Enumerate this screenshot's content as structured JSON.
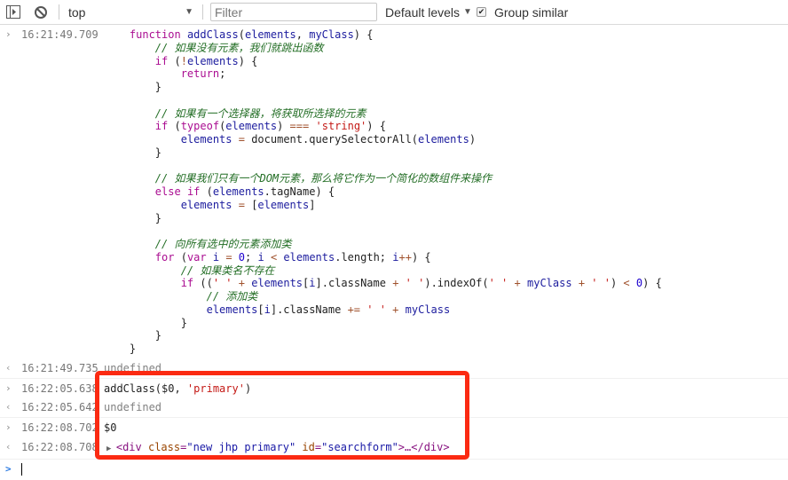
{
  "toolbar": {
    "context": "top",
    "filter_placeholder": "Filter",
    "levels": "Default levels",
    "group_similar": "Group similar",
    "group_similar_checked": true
  },
  "entries": [
    {
      "timestamp": "16:21:49.709",
      "kind": "input",
      "code": [
        [
          [
            "p",
            "    "
          ],
          [
            "k",
            "function"
          ],
          [
            "p",
            " "
          ],
          [
            "v",
            "addClass"
          ],
          [
            "p",
            "("
          ],
          [
            "v",
            "elements"
          ],
          [
            "p",
            ", "
          ],
          [
            "v",
            "myClass"
          ],
          [
            "p",
            ") {"
          ]
        ],
        [
          [
            "c",
            "        // 如果没有元素，我们就跳出函数"
          ]
        ],
        [
          [
            "p",
            "        "
          ],
          [
            "k",
            "if"
          ],
          [
            "p",
            " ("
          ],
          [
            "o",
            "!"
          ],
          [
            "v",
            "elements"
          ],
          [
            "p",
            ") {"
          ]
        ],
        [
          [
            "p",
            "            "
          ],
          [
            "k",
            "return"
          ],
          [
            "p",
            ";"
          ]
        ],
        [
          [
            "p",
            "        }"
          ]
        ],
        [],
        [
          [
            "c",
            "        // 如果有一个选择器，将获取所选择的元素"
          ]
        ],
        [
          [
            "p",
            "        "
          ],
          [
            "k",
            "if"
          ],
          [
            "p",
            " ("
          ],
          [
            "k",
            "typeof"
          ],
          [
            "p",
            "("
          ],
          [
            "v",
            "elements"
          ],
          [
            "p",
            ") "
          ],
          [
            "o",
            "==="
          ],
          [
            "p",
            " "
          ],
          [
            "s",
            "'string'"
          ],
          [
            "p",
            ") {"
          ]
        ],
        [
          [
            "p",
            "            "
          ],
          [
            "v",
            "elements"
          ],
          [
            "p",
            " "
          ],
          [
            "o",
            "="
          ],
          [
            "p",
            " document.querySelectorAll("
          ],
          [
            "v",
            "elements"
          ],
          [
            "p",
            ")"
          ]
        ],
        [
          [
            "p",
            "        }"
          ]
        ],
        [],
        [
          [
            "c",
            "        // 如果我们只有一个DOM元素，那么将它作为一个简化的数组件来操作"
          ]
        ],
        [
          [
            "p",
            "        "
          ],
          [
            "k",
            "else"
          ],
          [
            "p",
            " "
          ],
          [
            "k",
            "if"
          ],
          [
            "p",
            " ("
          ],
          [
            "v",
            "elements"
          ],
          [
            "p",
            ".tagName) {"
          ]
        ],
        [
          [
            "p",
            "            "
          ],
          [
            "v",
            "elements"
          ],
          [
            "p",
            " "
          ],
          [
            "o",
            "="
          ],
          [
            "p",
            " ["
          ],
          [
            "v",
            "elements"
          ],
          [
            "p",
            "]"
          ]
        ],
        [
          [
            "p",
            "        }"
          ]
        ],
        [],
        [
          [
            "c",
            "        // 向所有选中的元素添加类"
          ]
        ],
        [
          [
            "p",
            "        "
          ],
          [
            "k",
            "for"
          ],
          [
            "p",
            " ("
          ],
          [
            "k",
            "var"
          ],
          [
            "p",
            " "
          ],
          [
            "v",
            "i"
          ],
          [
            "p",
            " "
          ],
          [
            "o",
            "="
          ],
          [
            "p",
            " "
          ],
          [
            "n",
            "0"
          ],
          [
            "p",
            "; "
          ],
          [
            "v",
            "i"
          ],
          [
            "p",
            " "
          ],
          [
            "o",
            "<"
          ],
          [
            "p",
            " "
          ],
          [
            "v",
            "elements"
          ],
          [
            "p",
            ".length; "
          ],
          [
            "v",
            "i"
          ],
          [
            "o",
            "++"
          ],
          [
            "p",
            ") {"
          ]
        ],
        [
          [
            "c",
            "            // 如果类名不存在"
          ]
        ],
        [
          [
            "p",
            "            "
          ],
          [
            "k",
            "if"
          ],
          [
            "p",
            " (("
          ],
          [
            "s",
            "' '"
          ],
          [
            "p",
            " "
          ],
          [
            "o",
            "+"
          ],
          [
            "p",
            " "
          ],
          [
            "v",
            "elements"
          ],
          [
            "p",
            "["
          ],
          [
            "v",
            "i"
          ],
          [
            "p",
            "].className "
          ],
          [
            "o",
            "+"
          ],
          [
            "p",
            " "
          ],
          [
            "s",
            "' '"
          ],
          [
            "p",
            ").indexOf("
          ],
          [
            "s",
            "' '"
          ],
          [
            "p",
            " "
          ],
          [
            "o",
            "+"
          ],
          [
            "p",
            " "
          ],
          [
            "v",
            "myClass"
          ],
          [
            "p",
            " "
          ],
          [
            "o",
            "+"
          ],
          [
            "p",
            " "
          ],
          [
            "s",
            "' '"
          ],
          [
            "p",
            ") "
          ],
          [
            "o",
            "<"
          ],
          [
            "p",
            " "
          ],
          [
            "n",
            "0"
          ],
          [
            "p",
            ") {"
          ]
        ],
        [
          [
            "c",
            "                // 添加类"
          ]
        ],
        [
          [
            "p",
            "                "
          ],
          [
            "v",
            "elements"
          ],
          [
            "p",
            "["
          ],
          [
            "v",
            "i"
          ],
          [
            "p",
            "].className "
          ],
          [
            "o",
            "+="
          ],
          [
            "p",
            " "
          ],
          [
            "s",
            "' '"
          ],
          [
            "p",
            " "
          ],
          [
            "o",
            "+"
          ],
          [
            "p",
            " "
          ],
          [
            "v",
            "myClass"
          ]
        ],
        [
          [
            "p",
            "            }"
          ]
        ],
        [
          [
            "p",
            "        }"
          ]
        ],
        [
          [
            "p",
            "    }"
          ]
        ]
      ]
    },
    {
      "timestamp": "16:21:49.735",
      "kind": "output",
      "text": "undefined"
    },
    {
      "timestamp": "16:22:05.638",
      "kind": "input",
      "code": [
        [
          [
            "p",
            "addClass($0, "
          ],
          [
            "s",
            "'primary'"
          ],
          [
            "p",
            ")"
          ]
        ]
      ]
    },
    {
      "timestamp": "16:22:05.642",
      "kind": "output",
      "text": "undefined"
    },
    {
      "timestamp": "16:22:08.702",
      "kind": "input",
      "code": [
        [
          [
            "p",
            "$0"
          ]
        ]
      ]
    },
    {
      "timestamp": "16:22:08.708",
      "kind": "output-element",
      "element": {
        "open": "<div",
        "attr1_name": "class",
        "attr1_value": "\"new jhp primary\"",
        "attr2_name": "id",
        "attr2_value": "\"searchform\"",
        "close": ">…</div>"
      }
    }
  ],
  "prompt_symbol": ">",
  "highlight_color": "#fb2a12"
}
